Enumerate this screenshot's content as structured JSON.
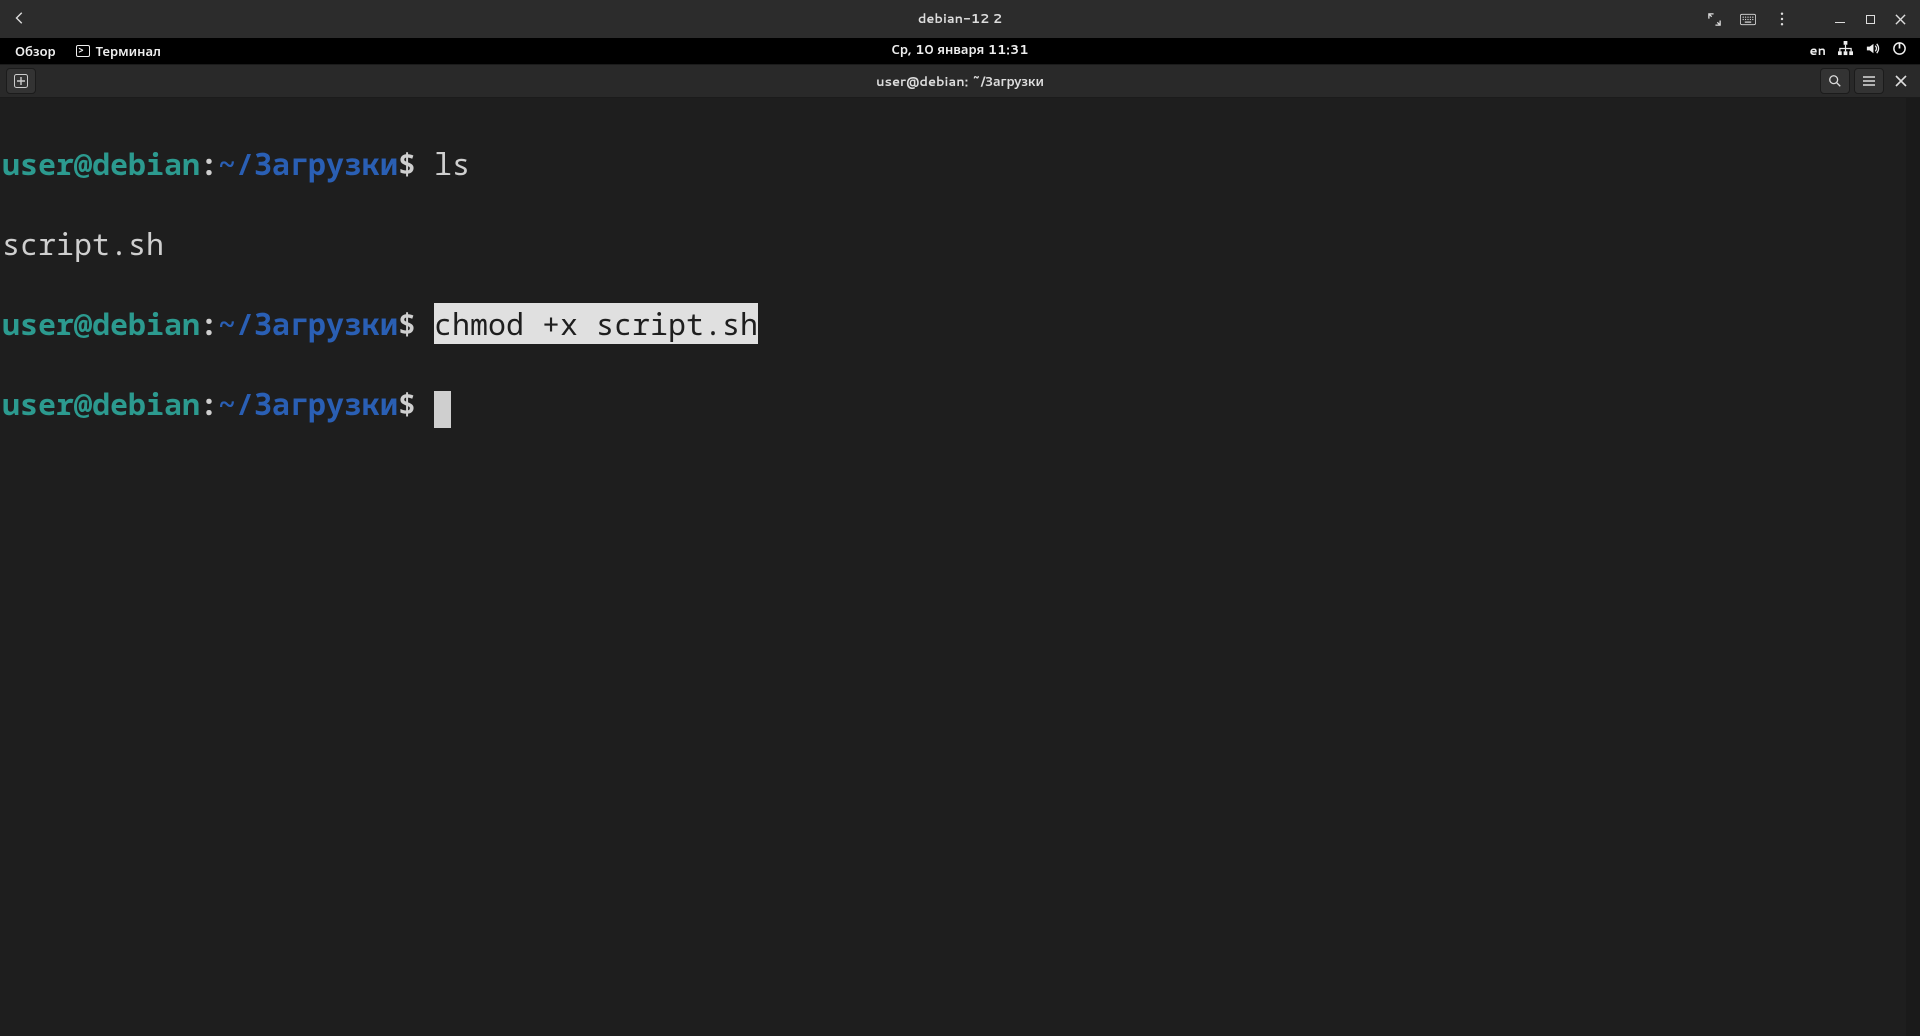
{
  "vm": {
    "title": "debian-12 2",
    "back_tooltip": "Back",
    "expand_tooltip": "Fullscreen",
    "keyboard_tooltip": "Send Key",
    "menu_tooltip": "Menu",
    "minimize_tooltip": "Minimize",
    "maximize_tooltip": "Maximize",
    "close_tooltip": "Close"
  },
  "gnome": {
    "activities": "Обзор",
    "app_name": "Терминал",
    "clock": "Ср, 10 января  11:31",
    "lang": "en"
  },
  "terminal_header": {
    "title": "user@debian: ~/Загрузки",
    "new_tab_tooltip": "New Tab",
    "search_tooltip": "Search",
    "menu_tooltip": "Menu",
    "close_tooltip": "Close"
  },
  "prompt": {
    "user": "user",
    "host": "debian",
    "path": "~/Загрузки",
    "separator": "@",
    "colon": ":",
    "dollar": "$"
  },
  "lines": {
    "l1_cmd": "ls",
    "l2_output": "script.sh",
    "l3_cmd": "chmod +x script.sh"
  }
}
